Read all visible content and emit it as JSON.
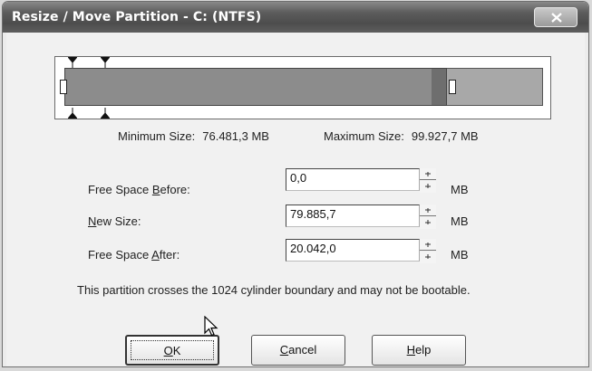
{
  "window": {
    "title": "Resize / Move Partition - C: (NTFS)"
  },
  "partition_graphic": {
    "used_fraction": 0.8,
    "colors": {
      "used": "#8c8c8c",
      "free": "#a8a8a8",
      "frame": "#ffffff"
    }
  },
  "sizes": {
    "min_label": "Minimum Size:",
    "min_value": "76.481,3 MB",
    "max_label": "Maximum Size:",
    "max_value": "99.927,7 MB"
  },
  "fields": [
    {
      "label_pre": "Free Space ",
      "label_key": "B",
      "label_post": "efore:",
      "value": "0,0",
      "unit": "MB"
    },
    {
      "label_pre": "",
      "label_key": "N",
      "label_post": "ew Size:",
      "value": "79.885,7",
      "unit": "MB"
    },
    {
      "label_pre": "Free Space ",
      "label_key": "A",
      "label_post": "fter:",
      "value": "20.042,0",
      "unit": "MB"
    }
  ],
  "notice": "This partition crosses the 1024 cylinder boundary and may not be bootable.",
  "buttons": {
    "ok_key": "O",
    "ok_rest": "K",
    "cancel_key": "C",
    "cancel_rest": "ancel",
    "help_key": "H",
    "help_rest": "elp"
  },
  "icons": {
    "close": "close-x-icon",
    "spin_up": "spin-up-arrow-icon",
    "spin_down": "spin-down-arrow-icon",
    "cursor": "mouse-pointer-icon"
  }
}
